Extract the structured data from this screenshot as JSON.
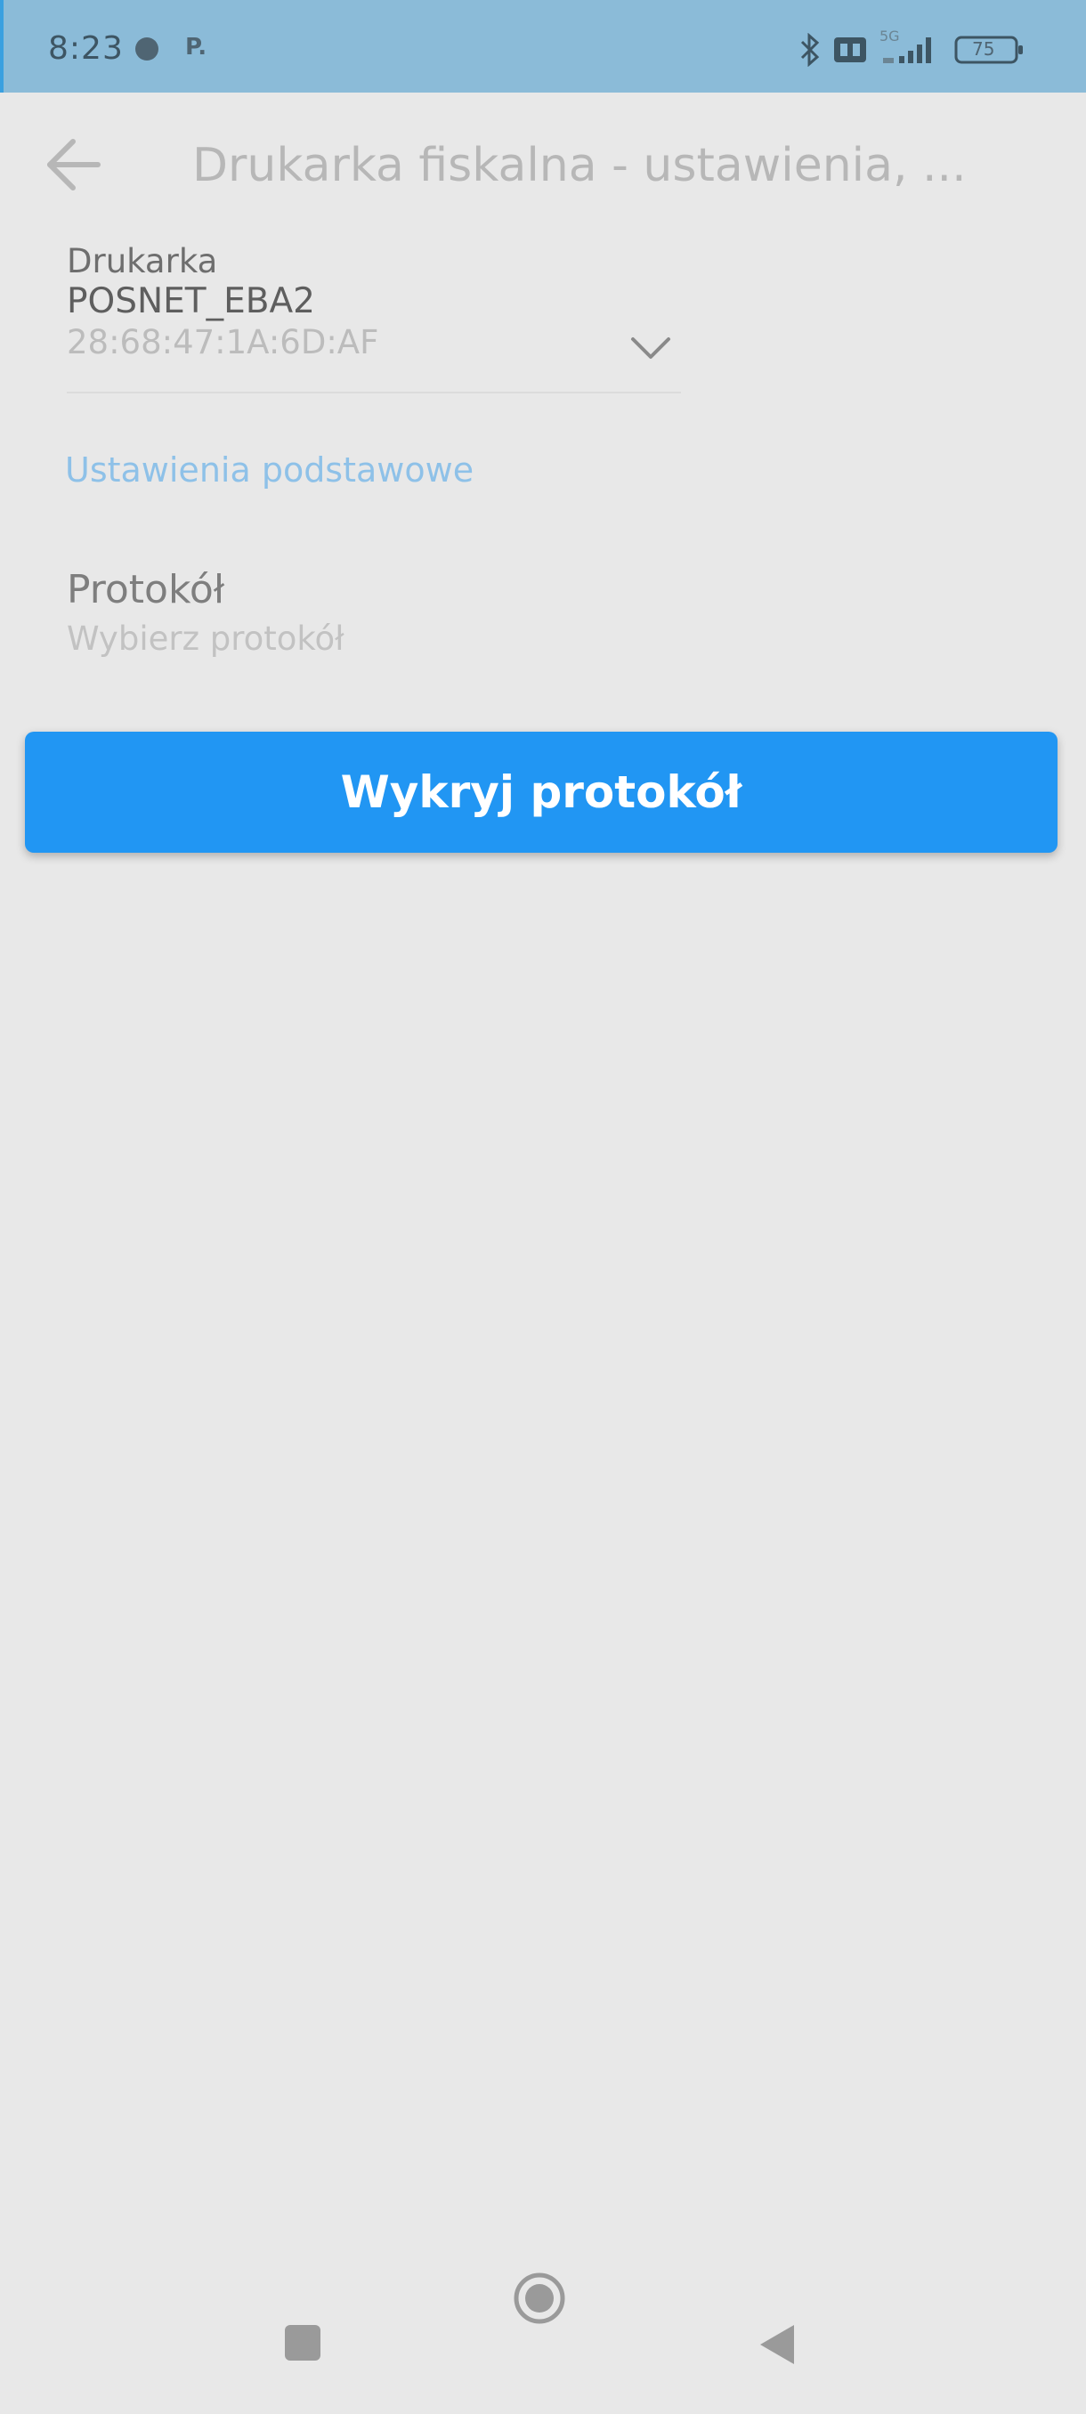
{
  "status_bar": {
    "time": "8:23",
    "carrier_glyph": "P.",
    "network_label": "5G",
    "battery_level": "75"
  },
  "app_bar": {
    "title": "Drukarka fiskalna - ustawienia, ..."
  },
  "printer": {
    "label": "Drukarka",
    "name": "POSNET_EBA2",
    "address": "28:68:47:1A:6D:AF"
  },
  "sections": {
    "basic_header": "Ustawienia podstawowe"
  },
  "protocol": {
    "title": "Protokół",
    "subtitle": "Wybierz protokół"
  },
  "actions": {
    "detect_protocol": "Wykryj protokół"
  },
  "colors": {
    "status_bar": "#8bbbd8",
    "background": "#e8e8e8",
    "accent": "#2196f3",
    "section_header": "#8ec1e8"
  },
  "icons": {
    "back": "arrow-left-icon",
    "dropdown": "chevron-down-icon",
    "nav_recents": "square-icon",
    "nav_home": "circle-icon",
    "nav_back": "triangle-back-icon"
  }
}
